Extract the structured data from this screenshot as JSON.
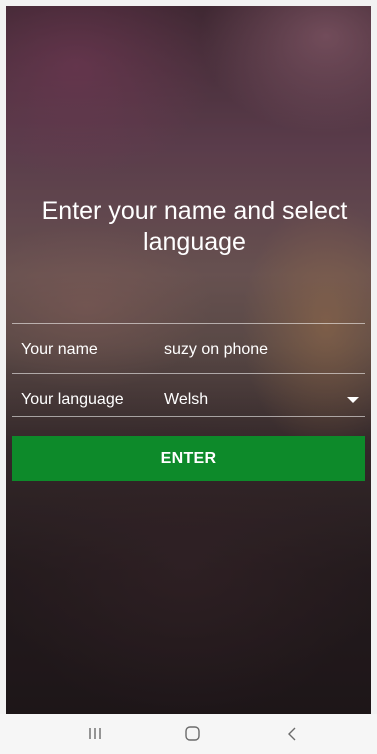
{
  "login": {
    "heading": "Enter your name and select language",
    "name_label": "Your name",
    "name_value": "suzy on phone",
    "language_label": "Your language",
    "language_selected": "Welsh",
    "enter_label": "ENTER"
  },
  "colors": {
    "accent": "#0d8a2a"
  },
  "navbar": {
    "recents_icon": "recents-icon",
    "home_icon": "home-icon",
    "back_icon": "back-icon"
  }
}
